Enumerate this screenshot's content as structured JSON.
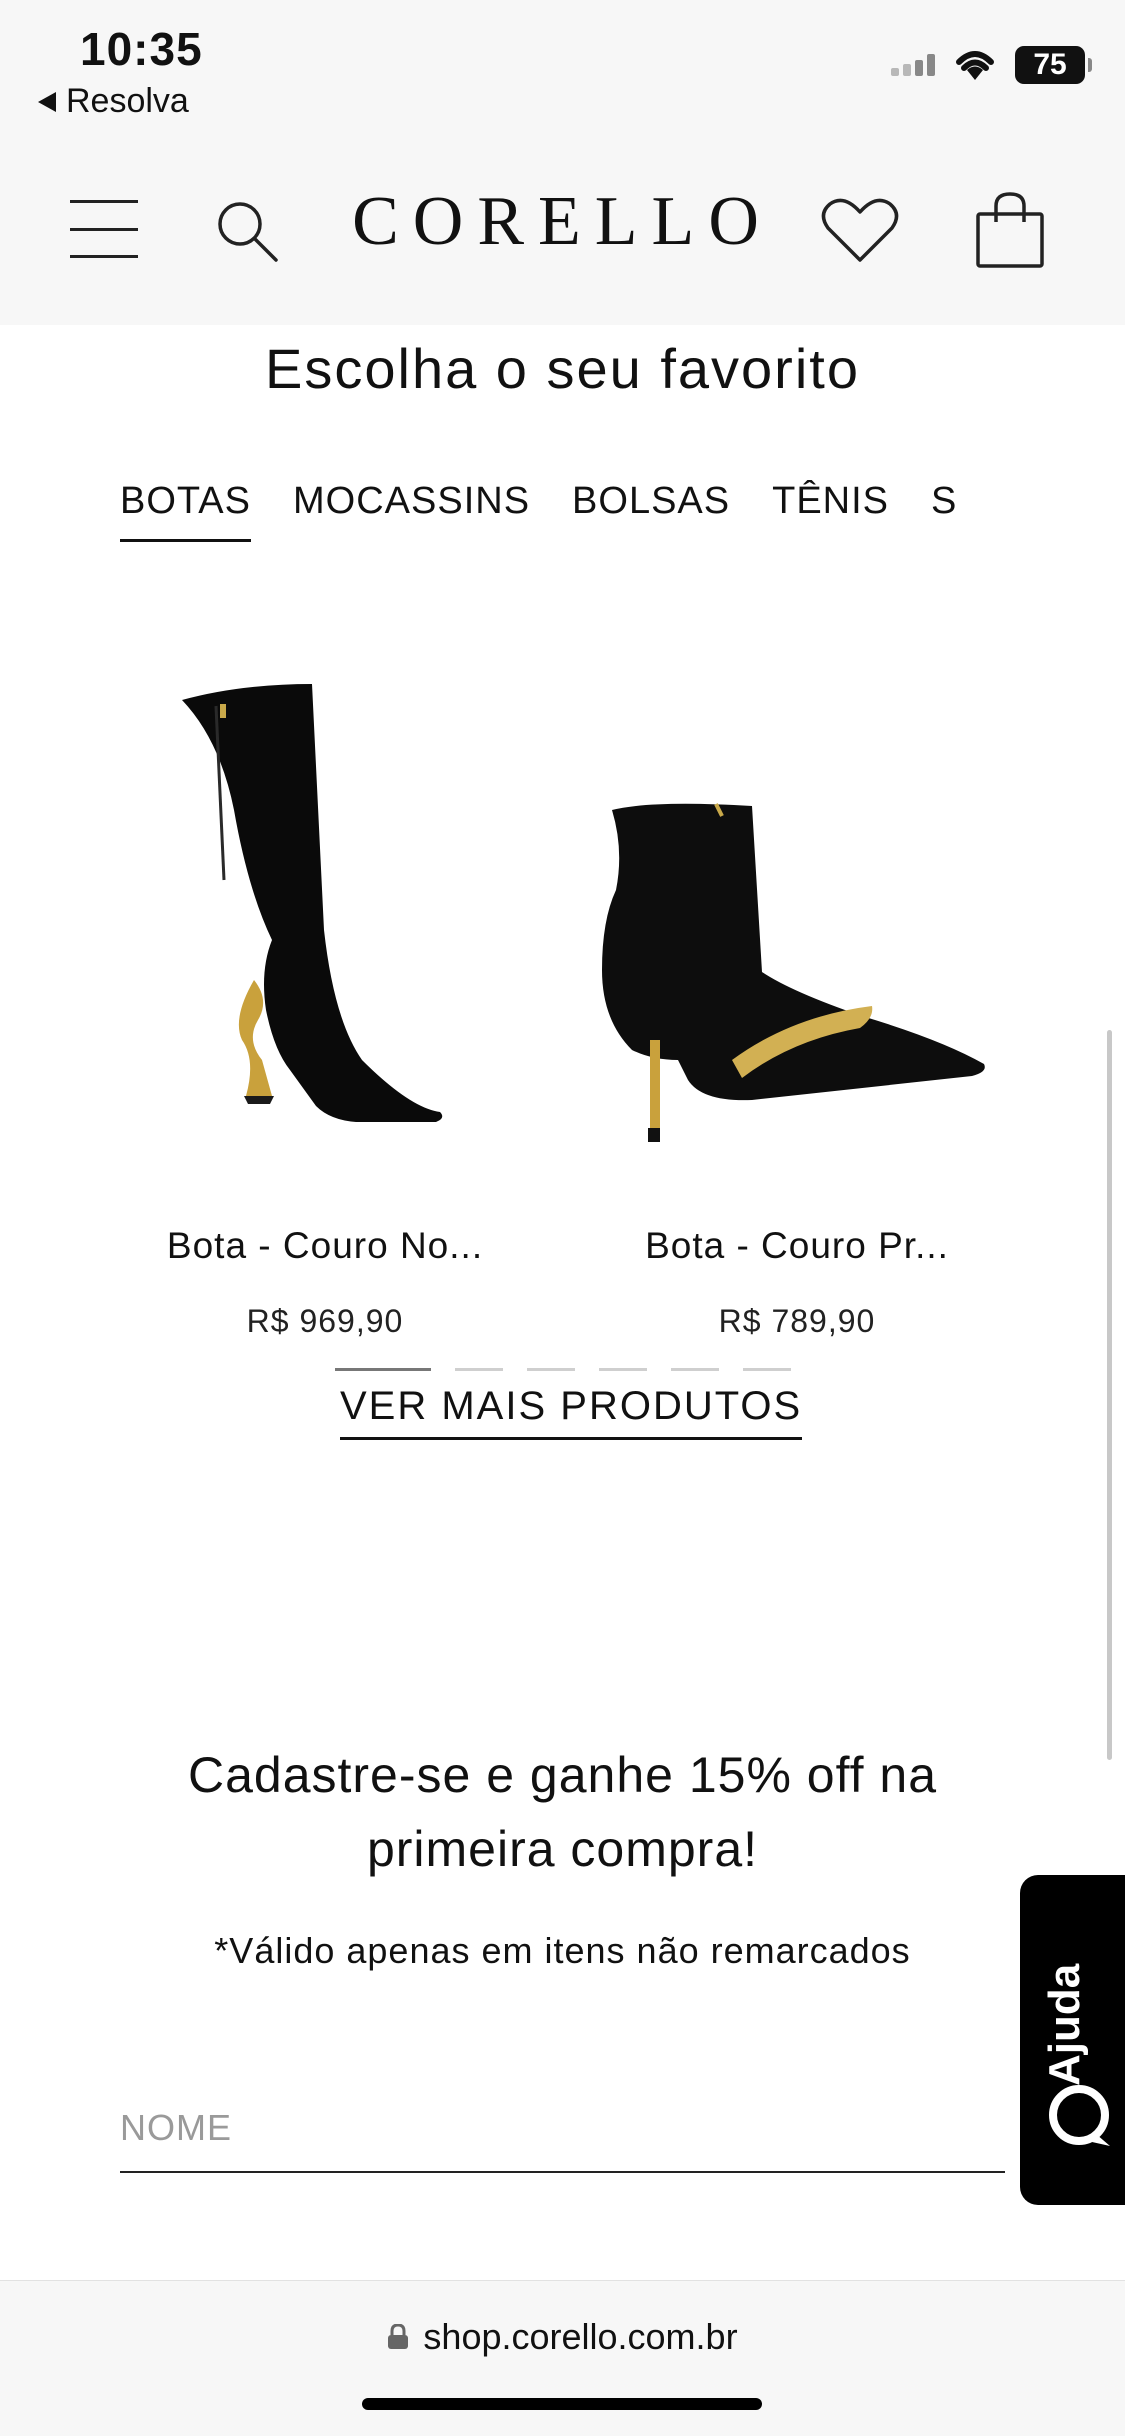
{
  "status_bar": {
    "time": "10:35",
    "back_label": "Resolva",
    "battery": "75"
  },
  "header": {
    "logo": "CORELLO",
    "icons": [
      "menu-icon",
      "search-icon",
      "heart-icon",
      "bag-icon"
    ]
  },
  "section": {
    "title": "Escolha o seu favorito",
    "tabs": [
      {
        "label": "BOTAS",
        "active": true
      },
      {
        "label": "MOCASSINS",
        "active": false
      },
      {
        "label": "BOLSAS",
        "active": false
      },
      {
        "label": "TÊNIS",
        "active": false
      },
      {
        "label": "S",
        "active": false
      }
    ]
  },
  "products": [
    {
      "name": "Bota - Couro No...",
      "price": "R$ 969,90"
    },
    {
      "name": "Bota - Couro Pr...",
      "price": "R$ 789,90"
    }
  ],
  "carousel": {
    "pages": 6,
    "current": 1
  },
  "more_button": "VER MAIS PRODUTOS",
  "newsletter": {
    "title_line1": "Cadastre-se e ganhe 15% off na",
    "title_line2": "primeira compra!",
    "note": "*Válido apenas em itens não remarcados",
    "name_placeholder": "NOME"
  },
  "help_button": "Ajuda",
  "browser": {
    "url": "shop.corello.com.br"
  }
}
